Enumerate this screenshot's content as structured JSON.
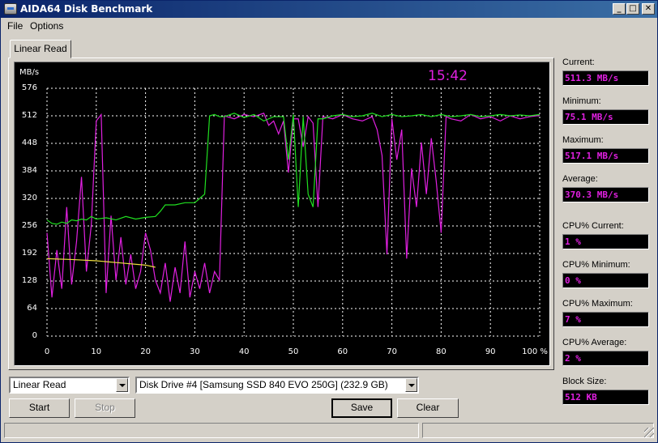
{
  "window": {
    "title": "AIDA64 Disk Benchmark",
    "controls": {
      "minimize": "_",
      "maximize": "□",
      "close": "✕"
    }
  },
  "menu": [
    "File",
    "Options"
  ],
  "tab": "Linear Read",
  "graph": {
    "unit_label": "MB/s",
    "elapsed_time": "15:42",
    "y_ticks": [
      "576",
      "512",
      "448",
      "384",
      "320",
      "256",
      "192",
      "128",
      "64",
      "0"
    ],
    "x_ticks": [
      "0",
      "10",
      "20",
      "30",
      "40",
      "50",
      "60",
      "70",
      "80",
      "90",
      "100 %"
    ],
    "colors": {
      "read": "#e020e0",
      "access": "#20e020",
      "cpu": "#f0e040",
      "grid": "#ffffff",
      "background": "#000000"
    }
  },
  "chart_data": {
    "type": "line",
    "xlim": [
      0,
      100
    ],
    "ylim": [
      0,
      576
    ],
    "grid": true,
    "series": [
      {
        "color": "#e020e0",
        "x": [
          0,
          1,
          2,
          3,
          4,
          5,
          6,
          7,
          8,
          9,
          10,
          11,
          12,
          13,
          14,
          15,
          16,
          17,
          18,
          19,
          20,
          21,
          22,
          23,
          24,
          25,
          26,
          27,
          28,
          29,
          30,
          31,
          32,
          33,
          34,
          35,
          36,
          38,
          40,
          42,
          44,
          45,
          46,
          47,
          48,
          49,
          50,
          51,
          52,
          53,
          54,
          55,
          56,
          58,
          60,
          62,
          64,
          66,
          67,
          68,
          69,
          70,
          71,
          72,
          73,
          74,
          75,
          76,
          77,
          78,
          79,
          80,
          81,
          82,
          84,
          86,
          88,
          90,
          92,
          94,
          96,
          98,
          100
        ],
        "y": [
          240,
          90,
          200,
          110,
          300,
          120,
          220,
          370,
          150,
          260,
          500,
          515,
          100,
          280,
          130,
          230,
          120,
          190,
          110,
          150,
          240,
          200,
          130,
          100,
          170,
          80,
          160,
          100,
          220,
          90,
          150,
          110,
          170,
          100,
          150,
          130,
          512,
          505,
          515,
          510,
          518,
          490,
          500,
          470,
          500,
          380,
          505,
          505,
          440,
          510,
          495,
          300,
          510,
          505,
          515,
          505,
          500,
          510,
          480,
          420,
          190,
          505,
          410,
          480,
          180,
          390,
          300,
          450,
          330,
          460,
          360,
          240,
          510,
          505,
          500,
          515,
          505,
          510,
          500,
          512,
          505,
          510,
          513
        ]
      },
      {
        "color": "#20e020",
        "x": [
          0,
          1,
          2,
          3,
          4,
          5,
          6,
          7,
          8,
          9,
          10,
          12,
          14,
          16,
          18,
          20,
          22,
          23,
          24,
          26,
          28,
          30,
          31,
          32,
          33,
          34,
          35,
          36,
          38,
          40,
          42,
          44,
          46,
          48,
          49,
          50,
          51,
          52,
          53,
          54,
          55,
          56,
          58,
          60,
          62,
          64,
          66,
          68,
          70,
          72,
          74,
          76,
          78,
          80,
          82,
          84,
          86,
          88,
          90,
          92,
          94,
          96,
          98,
          100
        ],
        "y": [
          270,
          262,
          260,
          265,
          262,
          270,
          268,
          272,
          270,
          278,
          272,
          275,
          270,
          278,
          272,
          276,
          278,
          290,
          305,
          305,
          310,
          310,
          320,
          330,
          512,
          515,
          510,
          510,
          518,
          508,
          515,
          500,
          510,
          510,
          410,
          515,
          300,
          510,
          330,
          300,
          505,
          505,
          512,
          515,
          510,
          512,
          518,
          510,
          515,
          510,
          512,
          515,
          510,
          515,
          510,
          512,
          515,
          510,
          512,
          515,
          512,
          514,
          512,
          515
        ]
      },
      {
        "color": "#f0e040",
        "x": [
          0,
          5,
          10,
          15,
          20,
          22
        ],
        "y": [
          180,
          178,
          175,
          170,
          165,
          160
        ]
      }
    ]
  },
  "stats": [
    {
      "label": "Current:",
      "value": "511.3 MB/s"
    },
    {
      "label": "Minimum:",
      "value": "75.1 MB/s"
    },
    {
      "label": "Maximum:",
      "value": "517.1 MB/s"
    },
    {
      "label": "Average:",
      "value": "370.3 MB/s"
    },
    {
      "label": "CPU% Current:",
      "value": "1 %"
    },
    {
      "label": "CPU% Minimum:",
      "value": "0 %"
    },
    {
      "label": "CPU% Maximum:",
      "value": "7 %"
    },
    {
      "label": "CPU% Average:",
      "value": "2 %"
    },
    {
      "label": "Block Size:",
      "value": "512 KB"
    }
  ],
  "controls": {
    "test_select": "Linear Read",
    "drive_select": "Disk Drive #4  [Samsung SSD 840 EVO 250G]  (232.9 GB)",
    "start": "Start",
    "stop": "Stop",
    "save": "Save",
    "clear": "Clear"
  }
}
